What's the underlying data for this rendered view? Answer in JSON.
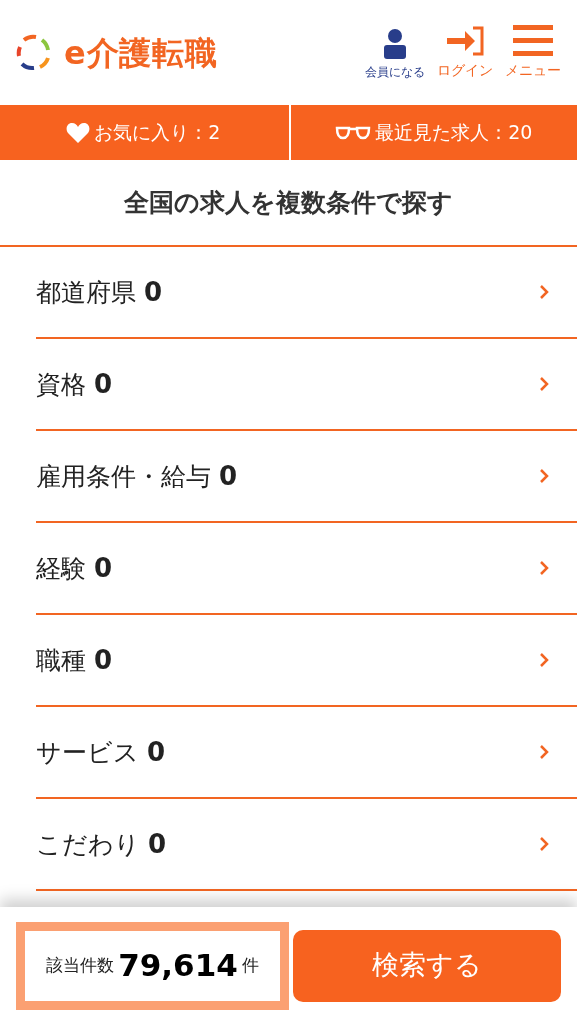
{
  "header": {
    "logo": "e介護転職",
    "actions": [
      {
        "kind": "member",
        "label": "会員になる"
      },
      {
        "kind": "login",
        "label": "ログイン"
      },
      {
        "kind": "menu",
        "label": "メニュー"
      }
    ]
  },
  "quick_links": [
    {
      "kind": "favorites",
      "label": "お気に入り：2"
    },
    {
      "kind": "recent",
      "label": "最近見た求人：20"
    }
  ],
  "title": "全国の求人を複数条件で探す",
  "filters": [
    {
      "label": "都道府県",
      "count": "0"
    },
    {
      "label": "資格",
      "count": "0"
    },
    {
      "label": "雇用条件・給与",
      "count": "0"
    },
    {
      "label": "経験",
      "count": "0"
    },
    {
      "label": "職種",
      "count": "0"
    },
    {
      "label": "サービス",
      "count": "0"
    },
    {
      "label": "こだわり",
      "count": "0"
    }
  ],
  "footer": {
    "result_label": "該当件数",
    "result_count": "79,614",
    "result_unit": "件",
    "search_button": "検索する"
  }
}
